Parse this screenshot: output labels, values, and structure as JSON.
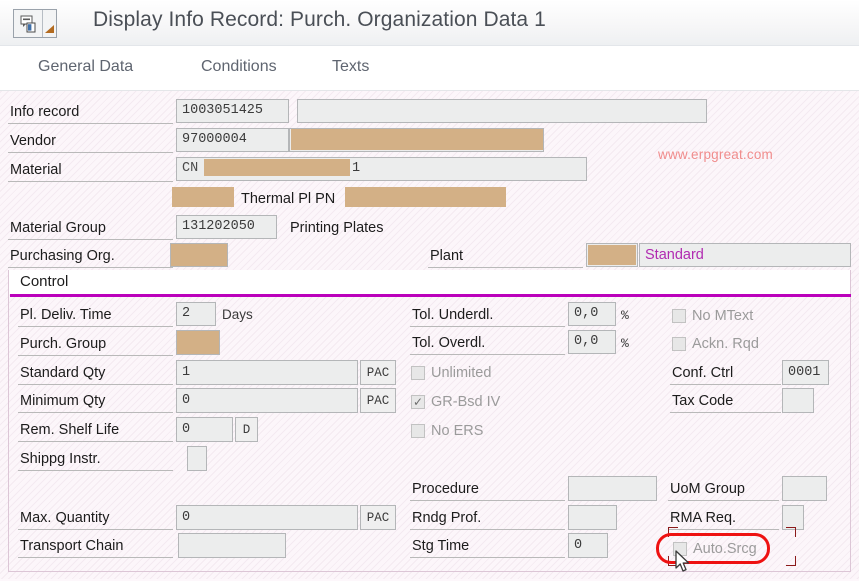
{
  "window": {
    "title": "Display Info Record: Purch. Organization Data 1",
    "toolbar_icon": "sap-menu-icon",
    "dropdown_icon": "dropdown-arrow-icon"
  },
  "tabs": [
    {
      "label": "General Data",
      "selected": true
    },
    {
      "label": "Conditions",
      "selected": false
    },
    {
      "label": "Texts",
      "selected": false
    }
  ],
  "header_fields": {
    "info_record": {
      "label": "Info record",
      "value": "1003051425",
      "desc_value": ""
    },
    "vendor": {
      "label": "Vendor",
      "value": "97000004",
      "desc_redacted": true
    },
    "material": {
      "label": "Material",
      "value_prefix": "CN",
      "value_suffix": "1",
      "redacted": true
    },
    "material_long_text": "Thermal Pl PN",
    "material_group": {
      "label": "Material Group",
      "value": "131202050",
      "desc": "Printing Plates"
    },
    "purchasing_org": {
      "label": "Purchasing Org.",
      "value": "",
      "redacted": true
    },
    "plant": {
      "label": "Plant",
      "value": "",
      "redacted": true,
      "desc": "Standard"
    }
  },
  "control_section": {
    "title": "Control",
    "left_column": [
      {
        "label": "Pl. Deliv. Time",
        "value": "2",
        "suffix": "Days"
      },
      {
        "label": "Purch. Group",
        "value": "",
        "redacted": true
      },
      {
        "label": "Standard Qty",
        "value": "1",
        "uom": "PAC"
      },
      {
        "label": "Minimum Qty",
        "value": "0",
        "uom": "PAC"
      },
      {
        "label": "Rem. Shelf Life",
        "value": "0",
        "uom": "D"
      },
      {
        "label": "Shippg Instr.",
        "value": ""
      },
      {
        "label": "Max. Quantity",
        "value": "0",
        "uom": "PAC"
      },
      {
        "label": "Transport Chain",
        "value": ""
      }
    ],
    "middle_column": [
      {
        "label": "Tol. Underdl.",
        "value": "0,0",
        "unit": "%"
      },
      {
        "label": "Tol. Overdl.",
        "value": "0,0",
        "unit": "%"
      },
      {
        "label": "Procedure",
        "value": ""
      },
      {
        "label": "Rndg Prof.",
        "value": ""
      },
      {
        "label": "Stg Time",
        "value": "0"
      }
    ],
    "middle_checkboxes": [
      {
        "label": "Unlimited",
        "checked": false
      },
      {
        "label": "GR-Bsd IV",
        "checked": true
      },
      {
        "label": "No ERS",
        "checked": false
      }
    ],
    "right_checkboxes": [
      {
        "label": "No MText",
        "checked": false
      },
      {
        "label": "Ackn. Rqd",
        "checked": false
      }
    ],
    "right_column": [
      {
        "label": "Conf. Ctrl",
        "value": "0001"
      },
      {
        "label": "Tax Code",
        "value": ""
      },
      {
        "label": "UoM Group",
        "value": ""
      },
      {
        "label": "RMA Req.",
        "value": ""
      }
    ],
    "highlighted_checkbox": {
      "label": "Auto.Srcg",
      "checked": false,
      "annotated": true
    }
  },
  "watermark": "www.erpgreat.com",
  "colors": {
    "accent_rule": "#bb00bb",
    "purple_text": "#b12bb1",
    "redaction": "#d3b086",
    "annotation_red": "#ee1111",
    "watermark": "#f08c8c"
  }
}
